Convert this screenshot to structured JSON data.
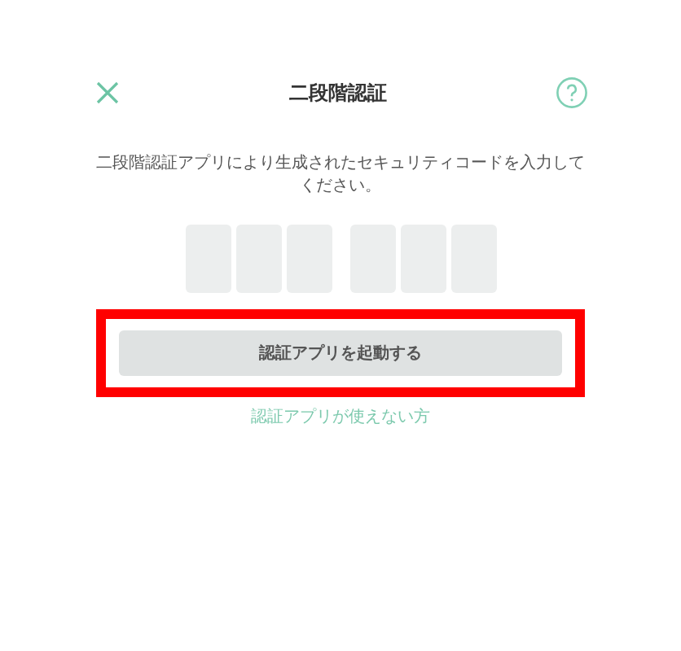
{
  "header": {
    "title": "二段階認証"
  },
  "instruction": "二段階認証アプリにより生成されたセキュリティコードを入力してください。",
  "primary_button": {
    "label": "認証アプリを起動する",
    "highlighted": true
  },
  "help_link": "認証アプリが使えない方"
}
